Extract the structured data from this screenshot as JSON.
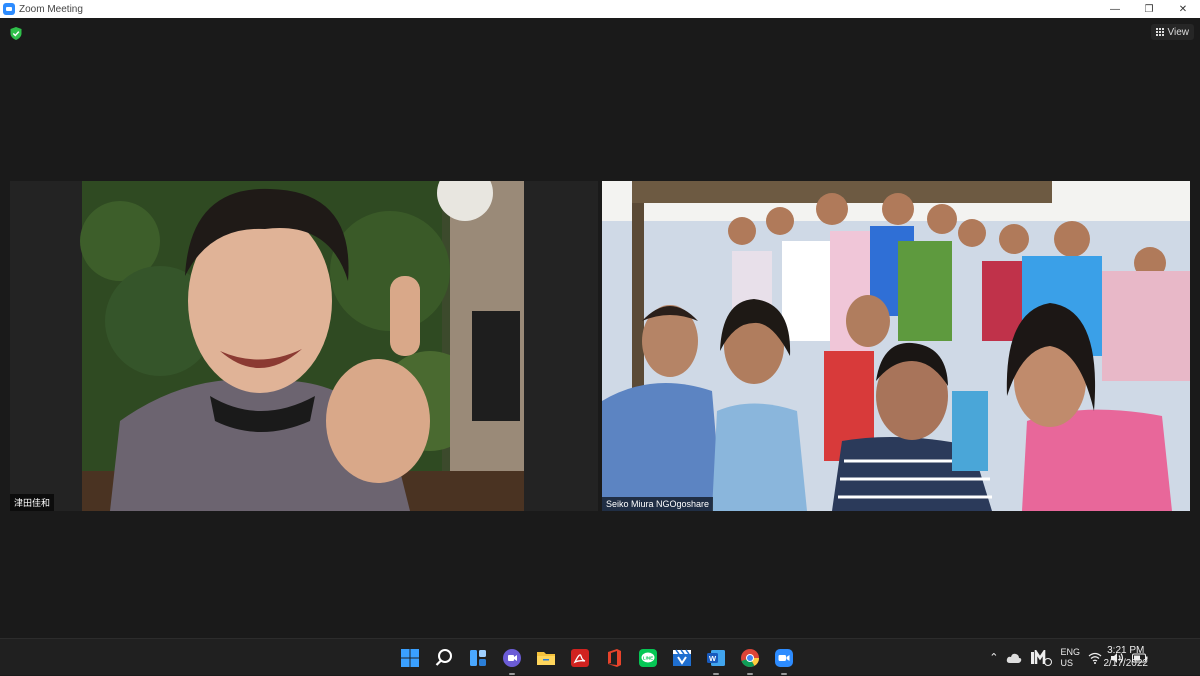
{
  "window": {
    "title": "Zoom Meeting",
    "minimize": "—",
    "restore": "❐",
    "close": "✕"
  },
  "meeting": {
    "view_label": "View",
    "participants": [
      {
        "name": "津田佳和"
      },
      {
        "name": "Seiko Miura NGOgoshare"
      }
    ]
  },
  "taskbar": {
    "apps": [
      "start-icon",
      "search-icon",
      "widgets-icon",
      "teams-chat-icon",
      "file-explorer-icon",
      "acrobat-icon",
      "office-icon",
      "line-icon",
      "clapper-icon",
      "word-icon",
      "chrome-icon",
      "zoom-icon"
    ],
    "tray": {
      "lang_top": "ENG",
      "lang_bottom": "US",
      "time": "3:21 PM",
      "date": "2/17/2022"
    }
  },
  "colors": {
    "accent": "#2d8cff",
    "shield": "#2fbf4a",
    "background": "#1a1a1a"
  }
}
